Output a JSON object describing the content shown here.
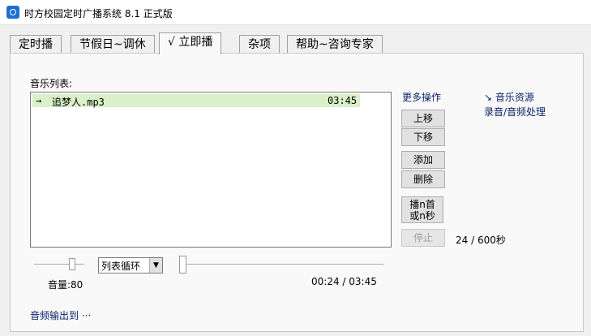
{
  "window": {
    "title": "时方校园定时广播系统 8.1 正式版"
  },
  "tabs": [
    {
      "label": "定时播"
    },
    {
      "label": "节假日~调休"
    },
    {
      "label": "√ 立即播"
    },
    {
      "label": "杂项"
    },
    {
      "label": "帮助~咨询专家"
    }
  ],
  "music": {
    "list_label": "音乐列表:",
    "tracks": [
      {
        "marker": "→",
        "name": "追梦人.mp3",
        "duration": "03:45"
      }
    ]
  },
  "links": {
    "more_ops": "更多操作",
    "music_resource": "↘ 音乐资源",
    "record_audio": "录音/音频处理",
    "audio_output": "音频输出到 ···"
  },
  "buttons": {
    "move_up": "上移",
    "move_down": "下移",
    "add": "添加",
    "delete": "删除",
    "play_first_line1": "播n首",
    "play_first_line2": "或n秒",
    "stop": "停止"
  },
  "counter": "24 / 600秒",
  "volume": {
    "label": "音量:80",
    "level": 80
  },
  "loop_mode": {
    "selected": "列表循环"
  },
  "playback": {
    "time": "00:24 / 03:45",
    "progress": 0.0
  },
  "colors": {
    "selected_row": "#d9f0c8",
    "link": "#0a246a",
    "app_icon": "#1c6fd1"
  }
}
